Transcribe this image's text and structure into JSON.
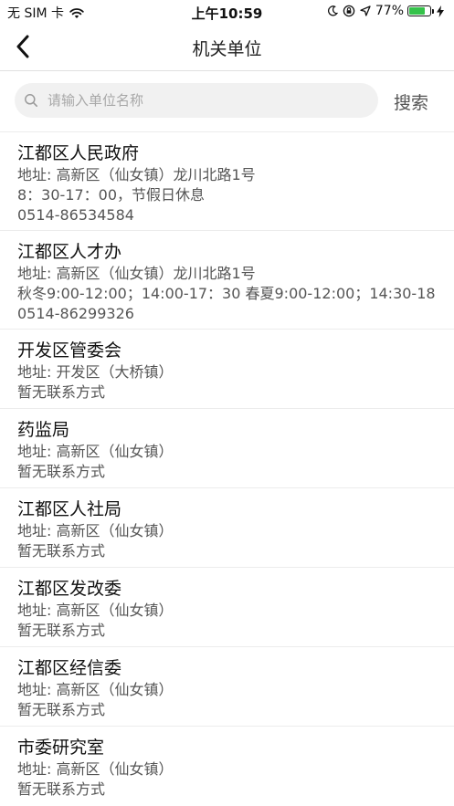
{
  "status_bar": {
    "carrier": "无 SIM 卡",
    "time": "上午10:59",
    "battery": "77%",
    "battery_level": 0.77,
    "battery_color": "#35c24a"
  },
  "nav": {
    "title": "机关单位"
  },
  "search": {
    "placeholder": "请输入单位名称",
    "value": "",
    "button_label": "搜索"
  },
  "units": [
    {
      "name": "江都区人民政府",
      "address": "地址: 高新区（仙女镇）龙川北路1号",
      "hours": "8：30-17：00，节假日休息",
      "phone": "0514-86534584"
    },
    {
      "name": "江都区人才办",
      "address": "地址: 高新区（仙女镇）龙川北路1号",
      "hours": "秋冬9:00-12:00；14:00-17：30 春夏9:00-12:00；14:30-18",
      "phone": "0514-86299326"
    },
    {
      "name": "开发区管委会",
      "address": "地址: 开发区（大桥镇）",
      "contact": "暂无联系方式"
    },
    {
      "name": "药监局",
      "address": "地址: 高新区（仙女镇）",
      "contact": "暂无联系方式"
    },
    {
      "name": "江都区人社局",
      "address": "地址: 高新区（仙女镇）",
      "contact": "暂无联系方式"
    },
    {
      "name": "江都区发改委",
      "address": "地址: 高新区（仙女镇）",
      "contact": "暂无联系方式"
    },
    {
      "name": "江都区经信委",
      "address": "地址: 高新区（仙女镇）",
      "contact": "暂无联系方式"
    },
    {
      "name": "市委研究室",
      "address": "地址: 高新区（仙女镇）",
      "contact": "暂无联系方式"
    }
  ]
}
